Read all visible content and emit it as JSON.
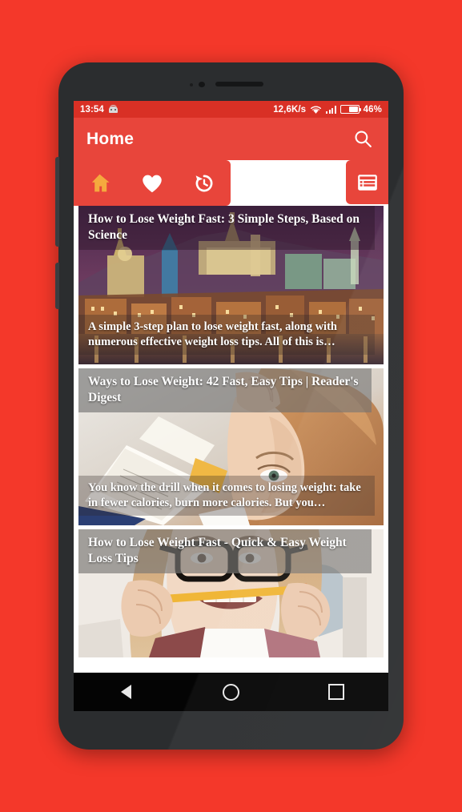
{
  "theme": {
    "page_background": "#f4382a",
    "accent_red": "#e8453b",
    "status_bar_red": "#d93025",
    "home_icon_orange": "#f5a93e",
    "nav_bar_black": "#040404"
  },
  "status_bar": {
    "time": "13:54",
    "robot_icon": "android-robot-icon",
    "network_speed": "12,6K/s",
    "wifi_icon": "wifi-icon",
    "signal_icon": "signal-bars-icon",
    "battery_icon": "battery-icon",
    "battery_percent": "46%"
  },
  "app_bar": {
    "title": "Home",
    "search_icon": "search-icon"
  },
  "tabs": [
    {
      "id": "home",
      "icon": "home-icon",
      "active": true
    },
    {
      "id": "favorites",
      "icon": "heart-icon",
      "active": false
    },
    {
      "id": "history",
      "icon": "history-icon",
      "active": false
    }
  ],
  "menu_button": {
    "icon": "list-article-icon"
  },
  "feed": {
    "cards": [
      {
        "title": "How to Lose Weight Fast: 3 Simple Steps, Based on Science",
        "description": "A simple 3-step plan to lose weight fast, along with numerous effective weight loss tips. All of this is…",
        "image_subject": "prague-castle-at-night"
      },
      {
        "title": "Ways to Lose Weight: 42 Fast, Easy Tips | Reader's Digest",
        "description": "You know the drill when it comes to losing weight: take in fewer calories, burn more calories. But you…",
        "image_subject": "girl-studying-with-books"
      },
      {
        "title": "How to Lose Weight Fast - Quick & Easy Weight Loss Tips",
        "description": "",
        "image_subject": "woman-with-glasses-biting-pencil"
      }
    ]
  },
  "nav_bar": {
    "back_icon": "back-triangle-icon",
    "home_icon": "home-circle-icon",
    "recents_icon": "recents-square-icon"
  }
}
